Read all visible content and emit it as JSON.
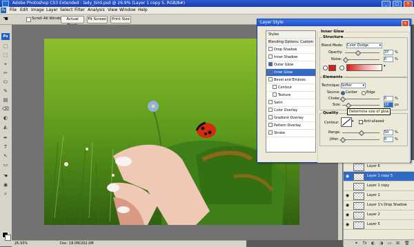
{
  "window": {
    "title": "Adobe Photoshop CS3 Extended - lady_bird.psd @ 26.9% (Layer 1 copy 5, RGB/8#)",
    "btn_min": "_",
    "btn_max": "□",
    "btn_close": "×"
  },
  "menu": {
    "logo": "Ps",
    "items": [
      "File",
      "Edit",
      "Image",
      "Layer",
      "Select",
      "Filter",
      "Analysis",
      "View",
      "Window",
      "Help"
    ]
  },
  "options": {
    "scroll_all_windows": "Scroll All Windows",
    "actual_pixels": "Actual Pixels",
    "fit_screen": "Fit Screen",
    "print_size": "Print Size"
  },
  "toolbox": {
    "logo": "Ps",
    "tools": [
      "⬚",
      "⬚",
      "⌖",
      "✂",
      "⬭",
      "✎",
      "▤",
      "⌫",
      "◐",
      "◭",
      "✒",
      "T",
      "↖",
      "▭",
      "☚",
      "◉",
      "⌕"
    ]
  },
  "status": {
    "zoom": "26.93%",
    "doc": "Doc: 18.0M/202.0M"
  },
  "dialog": {
    "title": "Layer Style",
    "close": "×",
    "list": [
      {
        "label": "Styles",
        "kind": "hdr"
      },
      {
        "label": "Blending Options: Custom",
        "kind": "hdr"
      },
      {
        "label": "Drop Shadow",
        "checked": false
      },
      {
        "label": "Inner Shadow",
        "checked": false
      },
      {
        "label": "Outer Glow",
        "checked": true
      },
      {
        "label": "Inner Glow",
        "checked": true,
        "selected": true
      },
      {
        "label": "Bevel and Emboss",
        "checked": false
      },
      {
        "label": "Contour",
        "checked": false,
        "sub": true
      },
      {
        "label": "Texture",
        "checked": false,
        "sub": true
      },
      {
        "label": "Satin",
        "checked": false
      },
      {
        "label": "Color Overlay",
        "checked": false
      },
      {
        "label": "Gradient Overlay",
        "checked": false
      },
      {
        "label": "Pattern Overlay",
        "checked": false
      },
      {
        "label": "Stroke",
        "checked": false
      }
    ],
    "inner_glow": "Inner Glow",
    "structure": "Structure",
    "blend_mode_label": "Blend Mode:",
    "blend_mode_value": "Color Dodge",
    "opacity_label": "Opacity:",
    "opacity_value": "37",
    "noise_label": "Noise:",
    "noise_value": "0",
    "pct": "%",
    "elements": "Elements",
    "technique_label": "Technique:",
    "technique_value": "Softer",
    "source_label": "Source:",
    "source_center": "Center",
    "source_edge": "Edge",
    "choke_label": "Choke:",
    "choke_value": "0",
    "size_label": "Size:",
    "size_value": "18",
    "px": "px",
    "quality": "Quality",
    "contour_label": "Contour:",
    "anti_aliased": "Anti-aliased",
    "range_label": "Range:",
    "range_value": "50",
    "jitter_label": "Jitter:",
    "jitter_value": "0",
    "glow_color": "#d91c1c"
  },
  "tooltip": "Determine size of glow",
  "layers": {
    "rows": [
      {
        "name": "Layer 6",
        "visible": false
      },
      {
        "name": "Layer 1 copy 5",
        "visible": true,
        "selected": true
      },
      {
        "name": "Layer 1 copy",
        "visible": false
      },
      {
        "name": "Layer 1",
        "visible": true
      },
      {
        "name": "Layer 1's Drop Shadow",
        "visible": true
      },
      {
        "name": "Layer 2",
        "visible": true
      },
      {
        "name": "Layer 5",
        "visible": true
      }
    ],
    "bottom_icons": [
      "⚭",
      "fx",
      "◐",
      "◑",
      "▭",
      "⊞",
      "🗑"
    ]
  }
}
